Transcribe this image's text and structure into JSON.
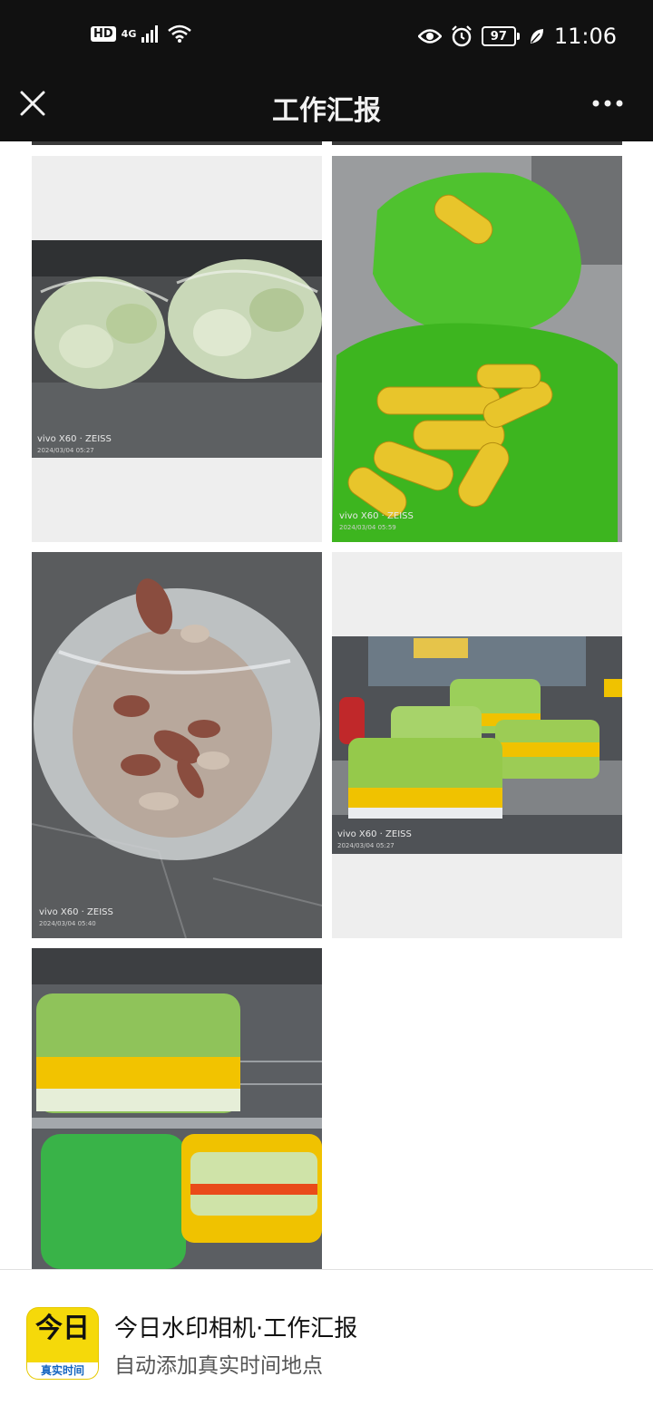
{
  "status_bar": {
    "hd": "HD",
    "network": "4G",
    "battery": "97",
    "time": "11:06"
  },
  "nav": {
    "title": "工作汇报"
  },
  "photos": [
    {
      "name": "cabbage-bags",
      "watermark": "vivo X60 · ZEISS",
      "date": "2024/03/04 05:27"
    },
    {
      "name": "corn-bags",
      "watermark": "vivo X60 · ZEISS",
      "date": "2024/03/04 05:59"
    },
    {
      "name": "sweet-potato-bag",
      "watermark": "vivo X60 · ZEISS",
      "date": "2024/03/04 05:40"
    },
    {
      "name": "cabbage-crates",
      "watermark": "vivo X60 · ZEISS",
      "date": "2024/03/04 05:27"
    },
    {
      "name": "lettuce-shelf"
    }
  ],
  "ad": {
    "logo_top": "今日",
    "logo_bottom": "真实时间",
    "title": "今日水印相机·工作汇报",
    "subtitle": "自动添加真实时间地点"
  },
  "colors": {
    "bar_background": "#111111",
    "logo_yellow": "#f5d90a",
    "logo_blue": "#1565c0"
  }
}
